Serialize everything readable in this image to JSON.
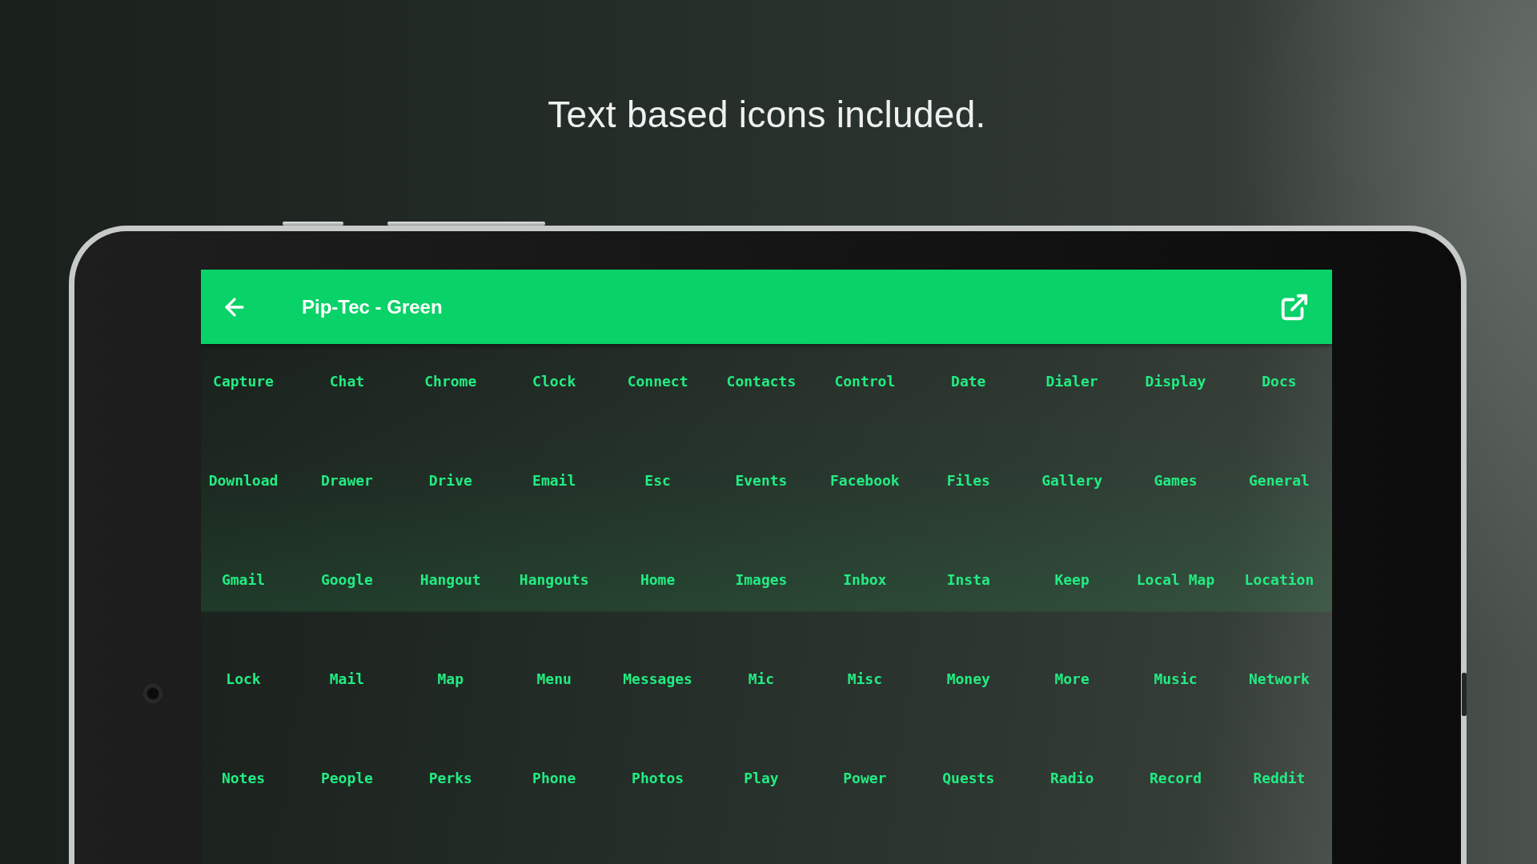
{
  "headline": "Text based icons included.",
  "app_bar": {
    "title": "Pip-Tec - Green"
  },
  "icon_labels": [
    "Capture",
    "Chat",
    "Chrome",
    "Clock",
    "Connect",
    "Contacts",
    "Control",
    "Date",
    "Dialer",
    "Display",
    "Docs",
    "Download",
    "Drawer",
    "Drive",
    "Email",
    "Esc",
    "Events",
    "Facebook",
    "Files",
    "Gallery",
    "Games",
    "General",
    "Gmail",
    "Google",
    "Hangout",
    "Hangouts",
    "Home",
    "Images",
    "Inbox",
    "Insta",
    "Keep",
    "Local Map",
    "Location",
    "Lock",
    "Mail",
    "Map",
    "Menu",
    "Messages",
    "Mic",
    "Misc",
    "Money",
    "More",
    "Music",
    "Network",
    "Notes",
    "People",
    "Perks",
    "Phone",
    "Photos",
    "Play",
    "Power",
    "Quests",
    "Radio",
    "Record",
    "Reddit"
  ]
}
